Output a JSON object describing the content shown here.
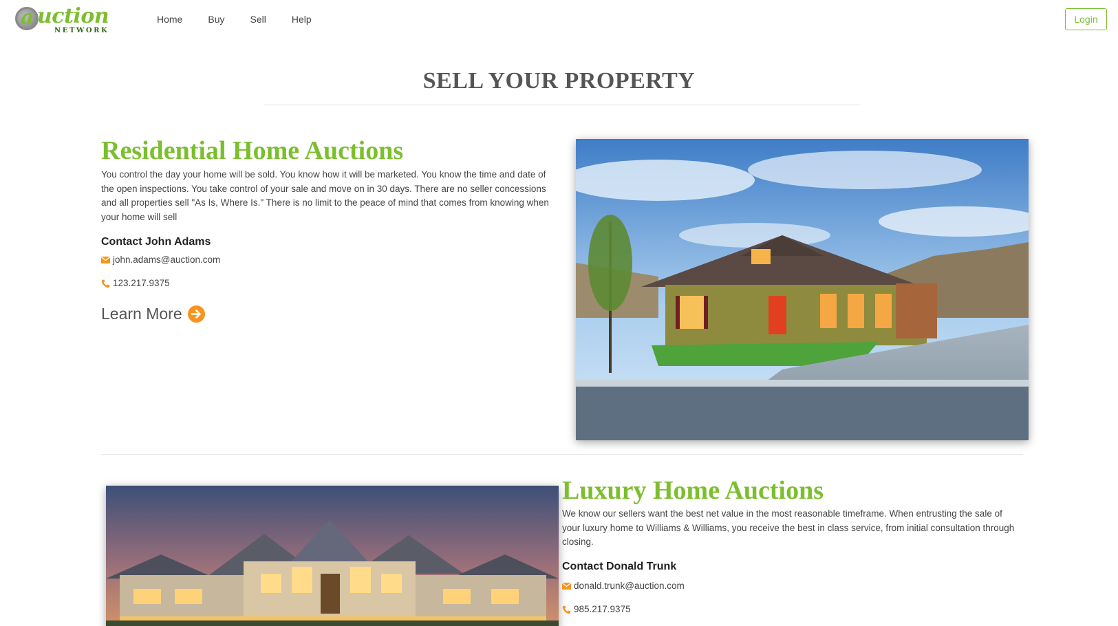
{
  "header": {
    "logo_word": "uction",
    "logo_a": "a",
    "logo_sub": "NETWORK",
    "nav": [
      "Home",
      "Buy",
      "Sell",
      "Help"
    ],
    "login_label": "Login"
  },
  "page": {
    "title": "SELL YOUR PROPERTY"
  },
  "residential": {
    "heading": "Residential Home Auctions",
    "body": "You control the day your home will be sold. You know how it will be marketed. You know the time and date of the open inspections. You take control of your sale and move on in 30 days. There are no seller concessions and all properties sell \"As Is, Where Is.\" There is no limit to the peace of mind that comes from knowing when your home will sell",
    "contact_name": "Contact John Adams",
    "email": "john.adams@auction.com",
    "phone": "123.217.9375",
    "learn_more": "Learn More"
  },
  "luxury": {
    "heading": "Luxury Home Auctions",
    "body": "We know our sellers want the best net value in the most reasonable timeframe. When entrusting the sale of your luxury home to Williams & Williams, you receive the best in class service, from initial consultation through closing.",
    "contact_name": "Contact Donald Trunk",
    "email": "donald.trunk@auction.com",
    "phone": "985.217.9375"
  },
  "colors": {
    "brand_green": "#7cbf2e",
    "accent_orange": "#f7941d"
  },
  "icons": {
    "email": "envelope-icon",
    "phone": "phone-icon",
    "learn_more": "arrow-circle-right-icon"
  }
}
